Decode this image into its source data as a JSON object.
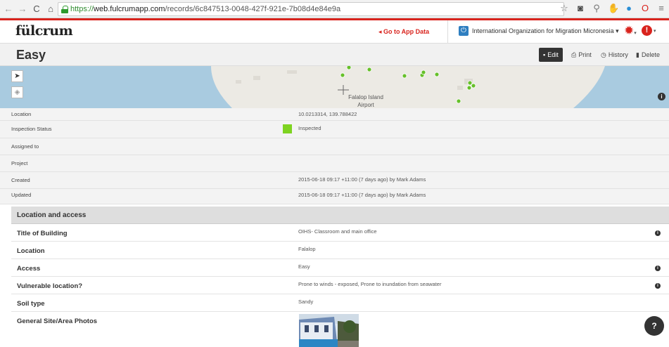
{
  "browser": {
    "url_secure": "https://",
    "url_host": "web.fulcrumapp.com",
    "url_path": "/records/6c847513-0048-427f-921e-7b08d4e84e9a"
  },
  "header": {
    "logo": "fülcrum",
    "go_to_app_data": "◂ Go to App Data",
    "organization": "International Organization for Migration Micronesia ▾",
    "alert_glyph": "!"
  },
  "record": {
    "title": "Easy",
    "actions": {
      "edit": "Edit",
      "print": "Print",
      "history": "History",
      "delete": "Delete"
    }
  },
  "map": {
    "place_label_1": "Falalop Island",
    "place_label_2": "Airport",
    "locate_glyph": "➤",
    "info_glyph": "i"
  },
  "meta": {
    "location_label": "Location",
    "location_value": "10.0213314, 139.788422",
    "status_label": "Inspection Status",
    "status_value": "Inspected",
    "status_color": "#7ed321",
    "assigned_label": "Assigned to",
    "assigned_value": "",
    "project_label": "Project",
    "project_value": "",
    "created_label": "Created",
    "created_value": "2015-06-18 09:17 +11:00 (7 days ago) by Mark Adams",
    "updated_label": "Updated",
    "updated_value": "2015-06-18 09:17 +11:00 (7 days ago) by Mark Adams"
  },
  "section": {
    "title": "Location and access",
    "fields": [
      {
        "label": "Title of Building",
        "value": "OIHS- Classroom and main office",
        "info": true
      },
      {
        "label": "Location",
        "value": "Falalop",
        "info": false
      },
      {
        "label": "Access",
        "value": "Easy",
        "info": true
      },
      {
        "label": "Vulnerable location?",
        "value": "Prone to winds - exposed, Prone to inundation from seawater",
        "info": true
      },
      {
        "label": "Soil type",
        "value": "Sandy",
        "info": false
      }
    ],
    "photos_label": "General Site/Area Photos"
  },
  "help": {
    "glyph": "?"
  },
  "colors": {
    "brand_red": "#d9231d",
    "map_water": "#a9cbe0",
    "map_land": "#eceae4",
    "marker_green": "#66c02a"
  }
}
